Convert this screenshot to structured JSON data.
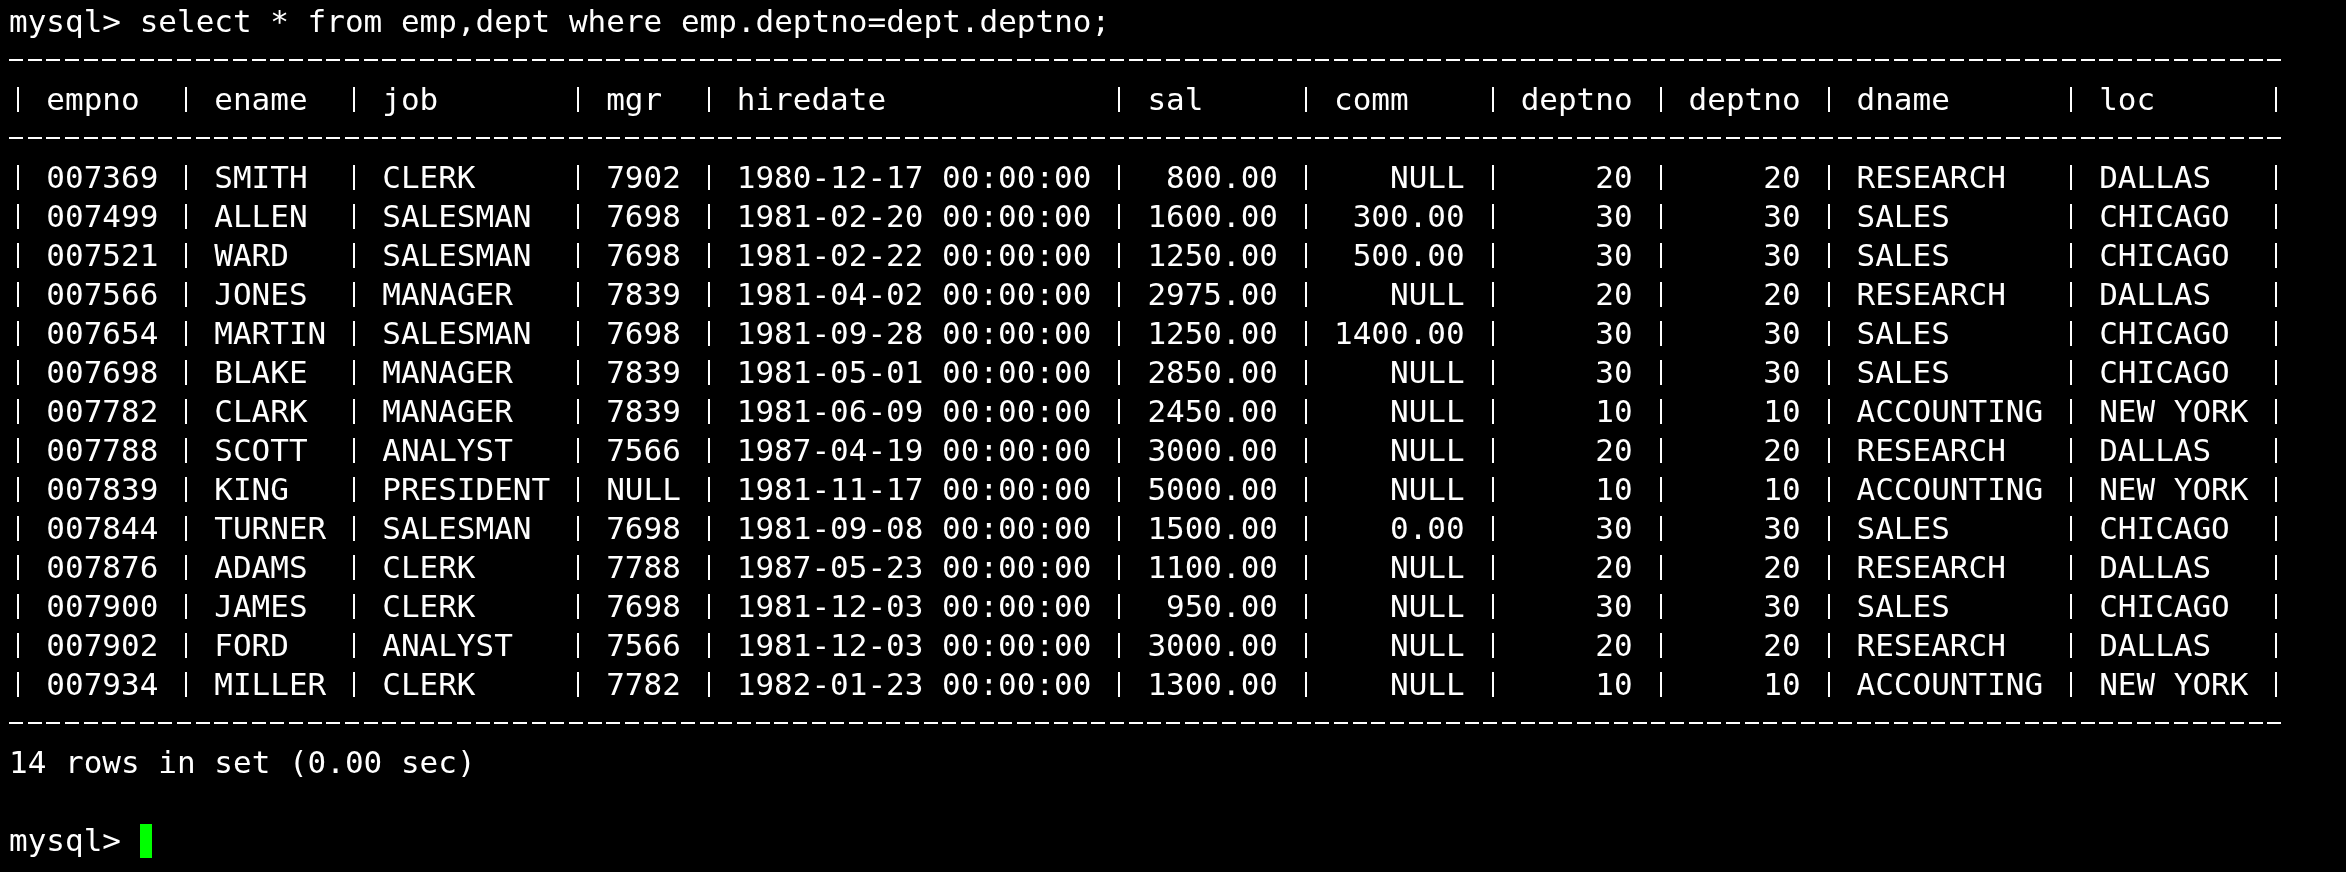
{
  "prompt": "mysql>",
  "command": "select * from emp,dept where emp.deptno=dept.deptno;",
  "table": {
    "columns": [
      "empno",
      "ename",
      "job",
      "mgr",
      "hiredate",
      "sal",
      "comm",
      "deptno",
      "deptno",
      "dname",
      "loc"
    ],
    "rows": [
      [
        "007369",
        "SMITH",
        "CLERK",
        "7902",
        "1980-12-17 00:00:00",
        "800.00",
        "NULL",
        "20",
        "20",
        "RESEARCH",
        "DALLAS"
      ],
      [
        "007499",
        "ALLEN",
        "SALESMAN",
        "7698",
        "1981-02-20 00:00:00",
        "1600.00",
        "300.00",
        "30",
        "30",
        "SALES",
        "CHICAGO"
      ],
      [
        "007521",
        "WARD",
        "SALESMAN",
        "7698",
        "1981-02-22 00:00:00",
        "1250.00",
        "500.00",
        "30",
        "30",
        "SALES",
        "CHICAGO"
      ],
      [
        "007566",
        "JONES",
        "MANAGER",
        "7839",
        "1981-04-02 00:00:00",
        "2975.00",
        "NULL",
        "20",
        "20",
        "RESEARCH",
        "DALLAS"
      ],
      [
        "007654",
        "MARTIN",
        "SALESMAN",
        "7698",
        "1981-09-28 00:00:00",
        "1250.00",
        "1400.00",
        "30",
        "30",
        "SALES",
        "CHICAGO"
      ],
      [
        "007698",
        "BLAKE",
        "MANAGER",
        "7839",
        "1981-05-01 00:00:00",
        "2850.00",
        "NULL",
        "30",
        "30",
        "SALES",
        "CHICAGO"
      ],
      [
        "007782",
        "CLARK",
        "MANAGER",
        "7839",
        "1981-06-09 00:00:00",
        "2450.00",
        "NULL",
        "10",
        "10",
        "ACCOUNTING",
        "NEW YORK"
      ],
      [
        "007788",
        "SCOTT",
        "ANALYST",
        "7566",
        "1987-04-19 00:00:00",
        "3000.00",
        "NULL",
        "20",
        "20",
        "RESEARCH",
        "DALLAS"
      ],
      [
        "007839",
        "KING",
        "PRESIDENT",
        "NULL",
        "1981-11-17 00:00:00",
        "5000.00",
        "NULL",
        "10",
        "10",
        "ACCOUNTING",
        "NEW YORK"
      ],
      [
        "007844",
        "TURNER",
        "SALESMAN",
        "7698",
        "1981-09-08 00:00:00",
        "1500.00",
        "0.00",
        "30",
        "30",
        "SALES",
        "CHICAGO"
      ],
      [
        "007876",
        "ADAMS",
        "CLERK",
        "7788",
        "1987-05-23 00:00:00",
        "1100.00",
        "NULL",
        "20",
        "20",
        "RESEARCH",
        "DALLAS"
      ],
      [
        "007900",
        "JAMES",
        "CLERK",
        "7698",
        "1981-12-03 00:00:00",
        "950.00",
        "NULL",
        "30",
        "30",
        "SALES",
        "CHICAGO"
      ],
      [
        "007902",
        "FORD",
        "ANALYST",
        "7566",
        "1981-12-03 00:00:00",
        "3000.00",
        "NULL",
        "20",
        "20",
        "RESEARCH",
        "DALLAS"
      ],
      [
        "007934",
        "MILLER",
        "CLERK",
        "7782",
        "1982-01-23 00:00:00",
        "1300.00",
        "NULL",
        "10",
        "10",
        "ACCOUNTING",
        "NEW YORK"
      ]
    ]
  },
  "status": "14 rows in set (0.00 sec)",
  "final_prompt": "mysql>"
}
